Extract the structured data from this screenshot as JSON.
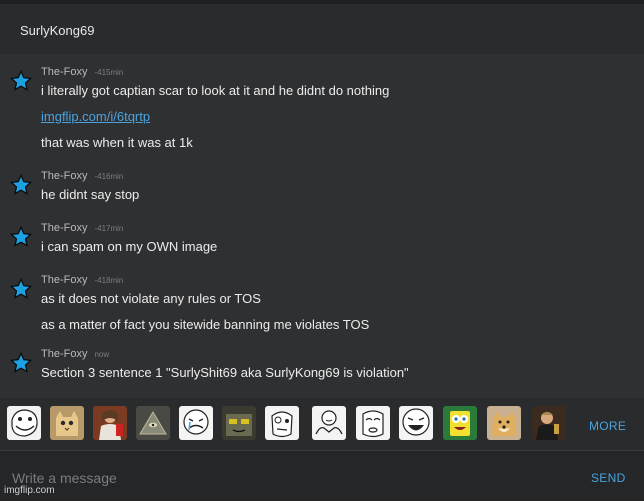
{
  "header": {
    "title": "SurlyKong69"
  },
  "messages": [
    {
      "author": "The-Foxy",
      "time": "-415min",
      "lines": [
        "i literally got captian scar to look at it and he didnt do nothing",
        "imgflip.com/i/6tqrtp",
        "that was when it was at 1k"
      ]
    },
    {
      "author": "The-Foxy",
      "time": "-416min",
      "lines": [
        "he didnt say stop"
      ]
    },
    {
      "author": "The-Foxy",
      "time": "-417min",
      "lines": [
        "i can spam on my OWN image"
      ]
    },
    {
      "author": "The-Foxy",
      "time": "-418min",
      "lines": [
        "as it does not violate any rules or TOS",
        "as a matter of fact you sitewide banning me violates TOS"
      ]
    },
    {
      "author": "The-Foxy",
      "time": "now",
      "lines": [
        "Section 3 sentence 1 \"SurlyShit69 aka SurlyKong69 is violation\""
      ]
    }
  ],
  "emoji_bar": {
    "items": [
      "troll-face",
      "cat",
      "jesus",
      "illuminati",
      "crying-face",
      "cool-face",
      "derp-face",
      "shrug-face",
      "me-gusta-face",
      "lol-face",
      "spongebob",
      "doge",
      "leonardo"
    ],
    "more_label": "MORE"
  },
  "compose": {
    "placeholder": "Write a message",
    "value": "",
    "send_label": "SEND"
  },
  "watermark": "imgflip.com",
  "colors": {
    "accent": "#4aa3df",
    "star": "#1da1e3",
    "background": "#2f3032"
  }
}
